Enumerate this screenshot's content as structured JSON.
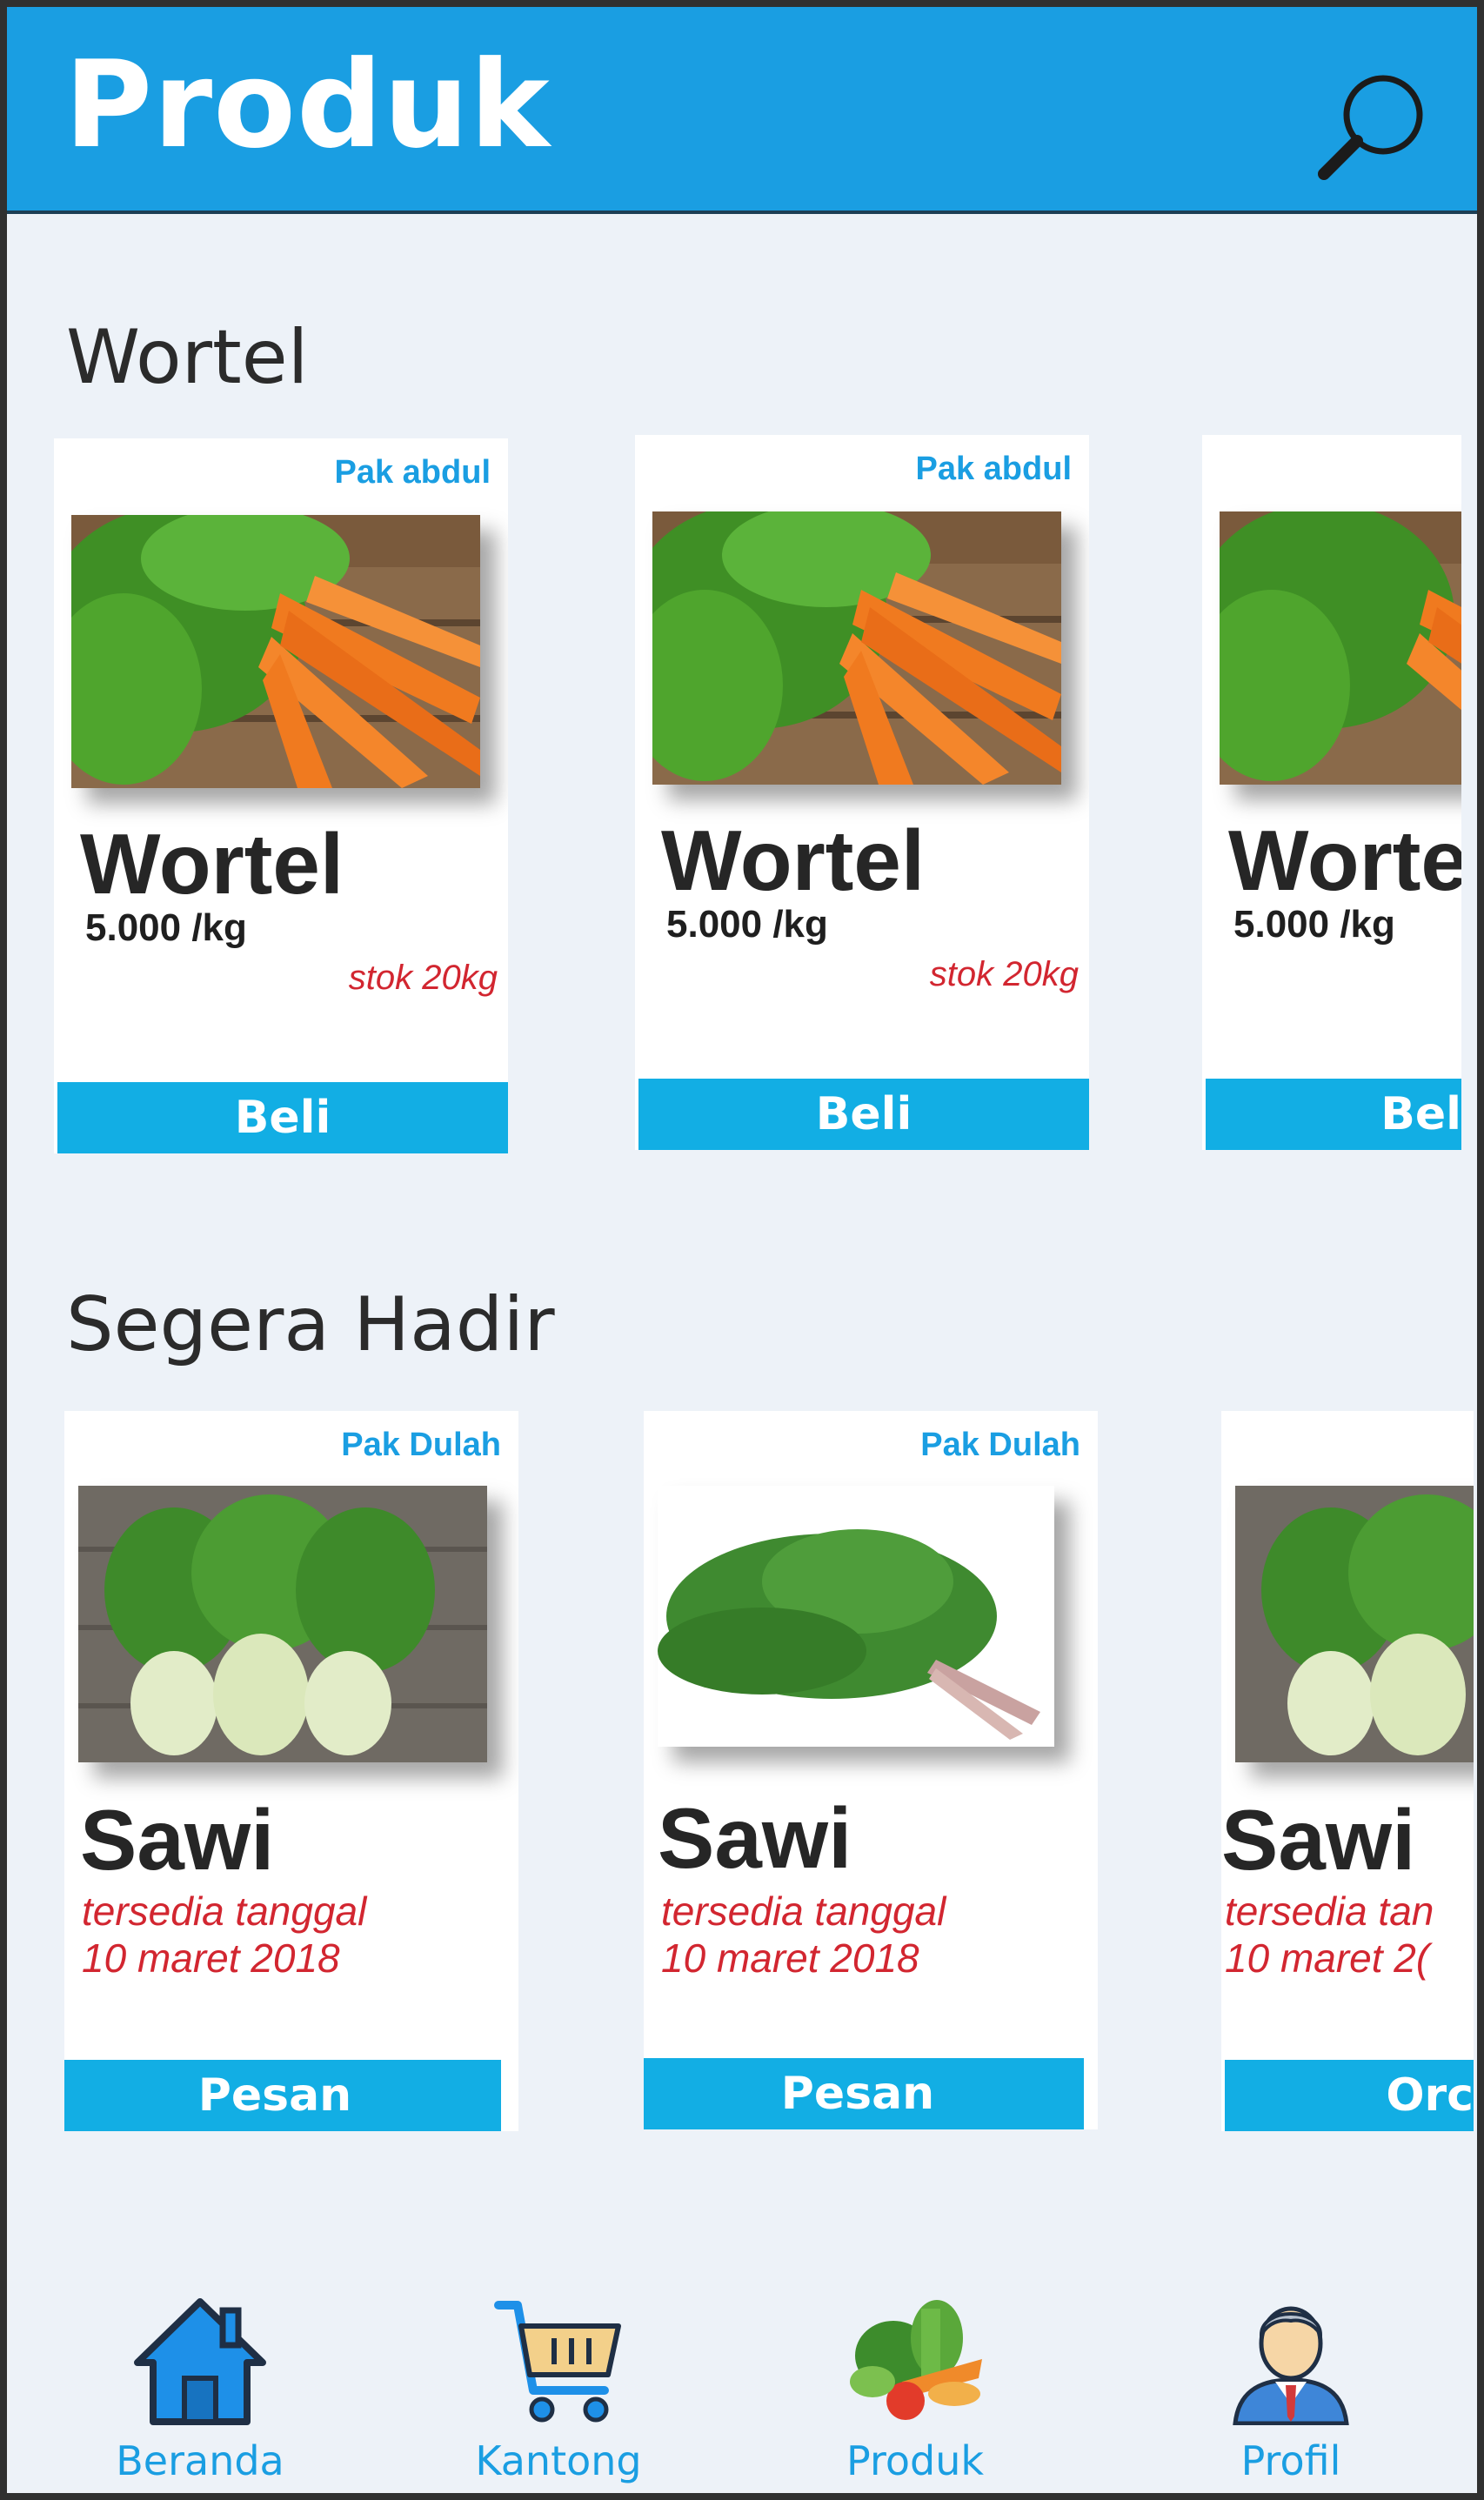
{
  "header": {
    "title": "Produk"
  },
  "sections": [
    {
      "title": "Wortel",
      "cards": [
        {
          "seller": "Pak abdul",
          "name": "Wortel",
          "price": "5.000 /kg",
          "stock": "stok 20kg",
          "button": "Beli"
        },
        {
          "seller": "Pak abdul",
          "name": "Wortel",
          "price": "5.000 /kg",
          "stock": "stok 20kg",
          "button": "Beli"
        },
        {
          "seller": "",
          "name": "Worte",
          "price": "5.000 /kg",
          "stock": "",
          "button": "Bel"
        }
      ]
    },
    {
      "title": "Segera Hadir",
      "cards": [
        {
          "seller": "Pak Dulah",
          "name": "Sawi",
          "available_line1": "tersedia tanggal",
          "available_line2": "10  maret 2018",
          "button": "Pesan"
        },
        {
          "seller": "Pak Dulah",
          "name": "Sawi",
          "available_line1": "tersedia tanggal",
          "available_line2": "10  maret 2018",
          "button": "Pesan"
        },
        {
          "seller": "",
          "name": "Sawi",
          "available_line1": "tersedia tan",
          "available_line2": "10  maret 2(",
          "button": "Orc"
        }
      ]
    }
  ],
  "nav": [
    {
      "label": "Beranda",
      "icon": "home-icon"
    },
    {
      "label": "Kantong",
      "icon": "cart-icon"
    },
    {
      "label": "Produk",
      "icon": "vegetables-icon"
    },
    {
      "label": "Profil",
      "icon": "user-icon"
    }
  ],
  "colors": {
    "primary": "#1a9ee2",
    "button": "#12aee4",
    "accent_red": "#d22630",
    "background": "#edf2f8"
  }
}
